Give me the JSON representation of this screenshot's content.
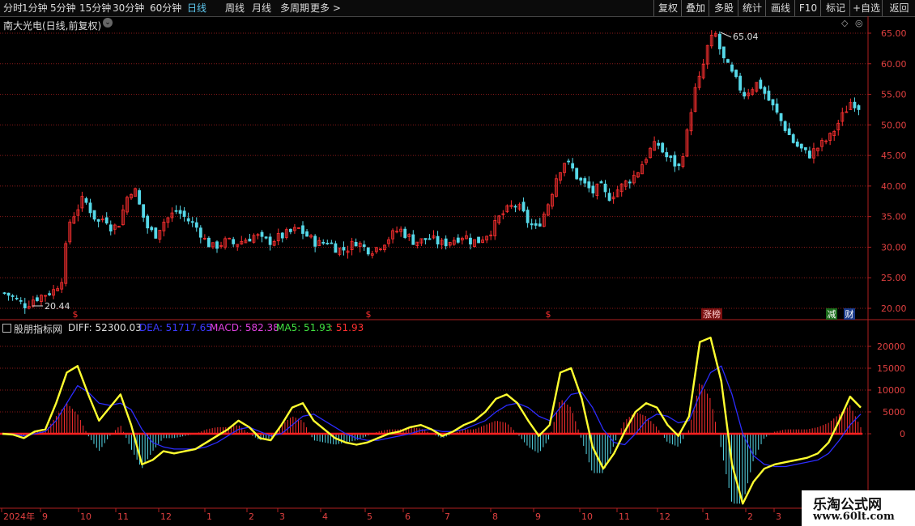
{
  "toolbar": {
    "left": [
      "分时",
      "1分钟",
      "5分钟",
      "15分钟",
      "30分钟",
      "60分钟",
      "日线",
      "周线",
      "月线",
      "多周期",
      "更多 >"
    ],
    "active": "日线",
    "right": [
      "复权",
      "叠加",
      "多股",
      "统计",
      "画线",
      "F10",
      "标记",
      "+自选",
      "返回"
    ]
  },
  "main_title": "南大光电(日线,前复权)",
  "price_axis": [
    "65.00",
    "60.00",
    "55.00",
    "50.00",
    "45.00",
    "40.00",
    "35.00",
    "30.00",
    "25.00",
    "20.00"
  ],
  "annotations": {
    "high": "65.04",
    "low": "20.44"
  },
  "event_marks": [
    "$",
    "$",
    "$"
  ],
  "badges": {
    "limit": "涨榜",
    "reduce": "减",
    "finance": "财"
  },
  "sub_panel": {
    "name": "股朋指标网",
    "diff": "DIFF: 52300.03",
    "dea": "DEA: 51717.65",
    "macd": "MACD: 582.38",
    "ma5": "MA5: 51.93",
    "extra": ": 51.93"
  },
  "sub_axis": [
    "20000",
    "15000",
    "10000",
    "5000",
    "0"
  ],
  "x_axis": [
    "2024年",
    "9",
    "10",
    "11",
    "12",
    "1",
    "2",
    "3",
    "4",
    "5",
    "6",
    "7",
    "8",
    "9",
    "10",
    "11",
    "12",
    "1",
    "2",
    "3"
  ],
  "watermark": {
    "line1": "乐淘公式网",
    "line2": "www.60lt.com"
  },
  "colors": {
    "up": "#ff3030",
    "down": "#56d8e8",
    "diff": "#ffff30",
    "dea": "#2c2cff",
    "grid": "#8b1a1a",
    "axis": "#b02020"
  },
  "chart_data": [
    {
      "type": "candlestick",
      "title": "南大光电(日线,前复权)",
      "ylim": [
        18,
        67
      ],
      "series_close_approx": [
        22.5,
        22,
        21,
        20.5,
        21.5,
        22,
        22.5,
        23,
        25,
        34,
        36,
        38,
        36,
        34,
        35,
        33,
        34,
        38,
        40,
        36,
        33,
        32,
        34,
        35,
        36,
        35,
        34,
        33,
        31,
        30,
        30.5,
        31,
        30.5,
        31,
        31.5,
        32,
        31,
        31,
        31.5,
        32,
        32.5,
        33,
        32,
        31,
        30.5,
        31,
        30,
        29.5,
        30,
        31,
        30,
        29.5,
        30,
        31,
        32,
        33,
        32,
        31,
        31,
        31.5,
        31,
        30.5,
        31,
        31.5,
        32,
        31,
        31,
        32,
        33,
        35,
        36,
        37,
        36,
        34,
        33,
        35,
        38,
        42,
        44,
        43,
        41,
        40,
        39,
        40,
        38,
        39,
        40,
        41,
        42,
        44,
        46,
        47,
        45,
        44,
        43,
        48,
        55,
        58,
        63,
        65,
        61,
        59,
        57,
        55,
        56,
        57,
        55,
        53,
        51,
        49,
        47,
        46,
        45,
        46,
        47,
        48,
        50,
        52,
        54,
        53
      ]
    },
    {
      "type": "line",
      "title": "股朋指标网",
      "ylim": [
        -17000,
        23000
      ],
      "series": [
        {
          "name": "DIFF",
          "values": [
            0,
            -200,
            -1000,
            500,
            1000,
            7000,
            14000,
            15500,
            9000,
            3000,
            6000,
            9000,
            2000,
            -7000,
            -6000,
            -4000,
            -4500,
            -4000,
            -3500,
            -2000,
            -500,
            1000,
            3000,
            1500,
            -1000,
            -1500,
            2000,
            6000,
            7000,
            3000,
            1000,
            -1000,
            -2000,
            -2500,
            -2000,
            -1000,
            0,
            500,
            1500,
            2000,
            1000,
            -500,
            500,
            2000,
            3000,
            5000,
            8000,
            9000,
            7000,
            3000,
            -500,
            2000,
            14000,
            15000,
            8000,
            -3000,
            -8000,
            -4500,
            500,
            5000,
            7000,
            6000,
            2000,
            -500,
            4000,
            21000,
            22000,
            12000,
            -7000,
            -16000,
            -11000,
            -8000,
            -7000,
            -6500,
            -6000,
            -5500,
            -4500,
            -2000,
            3000,
            8500,
            6000
          ]
        },
        {
          "name": "DEA",
          "values": [
            0,
            -100,
            -500,
            0,
            500,
            3000,
            7000,
            11000,
            9500,
            7000,
            6500,
            7000,
            5500,
            1000,
            -2000,
            -3000,
            -3500,
            -3500,
            -3500,
            -3000,
            -2000,
            -500,
            1000,
            1500,
            500,
            -500,
            0,
            2000,
            4000,
            4500,
            3000,
            1500,
            0,
            -1000,
            -1500,
            -1500,
            -1000,
            -500,
            0,
            800,
            1000,
            500,
            500,
            1000,
            2000,
            3000,
            5000,
            6500,
            7000,
            6000,
            4000,
            3000,
            6000,
            9000,
            9500,
            6000,
            1000,
            -2000,
            -2500,
            0,
            3000,
            4500,
            4000,
            2500,
            3000,
            9000,
            14000,
            15500,
            9000,
            0,
            -5000,
            -7000,
            -7500,
            -7500,
            -7000,
            -6500,
            -6000,
            -4500,
            -1500,
            2000,
            4500
          ]
        },
        {
          "name": "MACD",
          "values": [
            0,
            -100,
            -500,
            500,
            500,
            4000,
            7000,
            4500,
            -500,
            -4000,
            -500,
            2000,
            -3500,
            -8000,
            -4000,
            -1000,
            -1000,
            -500,
            0,
            1000,
            1500,
            1500,
            2000,
            0,
            -1500,
            -1000,
            2000,
            4000,
            3000,
            -1500,
            -2000,
            -2500,
            -2000,
            -1500,
            -500,
            500,
            1000,
            1000,
            1500,
            1200,
            0,
            -1000,
            0,
            1000,
            1000,
            2000,
            3000,
            2500,
            0,
            -3000,
            -4500,
            -1000,
            8000,
            6000,
            -1500,
            -9000,
            -9000,
            -2500,
            3000,
            5000,
            4000,
            1500,
            -2000,
            -3000,
            1000,
            12000,
            8000,
            -3500,
            -16000,
            -16000,
            -6000,
            -1000,
            500,
            1000,
            1000,
            1000,
            1500,
            2500,
            4500,
            6500,
            1500
          ]
        }
      ],
      "x_ticks": [
        "2024年",
        "9",
        "10",
        "11",
        "12",
        "1",
        "2",
        "3",
        "4",
        "5",
        "6",
        "7",
        "8",
        "9",
        "10",
        "11",
        "12",
        "1",
        "2",
        "3"
      ]
    }
  ]
}
